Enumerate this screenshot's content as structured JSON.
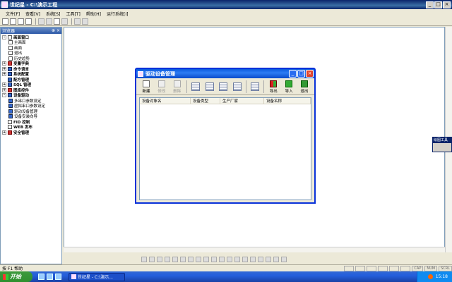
{
  "window": {
    "title": "世纪星 - C:\\演示工程",
    "controls": [
      "_",
      "□",
      "×"
    ]
  },
  "menu": [
    "文件[F]",
    "查看[V]",
    "系统[S]",
    "工具[T]",
    "帮助[H]",
    "运行系统[I]"
  ],
  "explorer": {
    "title": "浏览器",
    "tree": [
      {
        "label": "画面窗口",
        "level": 0,
        "expander": "-",
        "icon": "page",
        "bold": true
      },
      {
        "label": "主画面",
        "level": 1,
        "icon": "page"
      },
      {
        "label": "画面",
        "level": 1,
        "icon": "page"
      },
      {
        "label": "退出",
        "level": 1,
        "icon": "page"
      },
      {
        "label": "历史趋势",
        "level": 1,
        "icon": "page"
      },
      {
        "label": "变量字典",
        "level": 0,
        "expander": "+",
        "icon": "red",
        "bold": true
      },
      {
        "label": "命令语言",
        "level": 0,
        "expander": "+",
        "icon": "blue",
        "bold": true
      },
      {
        "label": "系统配置",
        "level": 0,
        "expander": "+",
        "icon": "blue",
        "bold": true
      },
      {
        "label": "配方管理",
        "level": 0,
        "expander": "",
        "icon": "blue",
        "bold": true
      },
      {
        "label": "SQL 管理",
        "level": 0,
        "expander": "+",
        "icon": "blue",
        "bold": true
      },
      {
        "label": "图库控件",
        "level": 0,
        "expander": "+",
        "icon": "red",
        "bold": true
      },
      {
        "label": "设备驱动",
        "level": 0,
        "expander": "-",
        "icon": "blue",
        "bold": true
      },
      {
        "label": "多串口参数设定",
        "level": 1,
        "icon": "blue"
      },
      {
        "label": "虚拟串口参数设定",
        "level": 1,
        "icon": "blue"
      },
      {
        "label": "驱动设备管理",
        "level": 1,
        "icon": "blue"
      },
      {
        "label": "设备安装向导",
        "level": 1,
        "icon": "blue"
      },
      {
        "label": "FID 控制",
        "level": 0,
        "expander": "",
        "icon": "page",
        "bold": true
      },
      {
        "label": "WEB 发布",
        "level": 0,
        "expander": "",
        "icon": "page",
        "bold": true
      },
      {
        "label": "安全管理",
        "level": 0,
        "expander": "+",
        "icon": "red",
        "bold": true
      }
    ]
  },
  "draw_tools": {
    "title": "绘图工具"
  },
  "dialog": {
    "title": "驱动设备管理",
    "buttons": {
      "new": "新建",
      "modify": "修改",
      "delete": "删除",
      "export": "导出",
      "import": "导入",
      "exit": "退出"
    },
    "columns": [
      "设备对象名",
      "设备类型",
      "生产厂家",
      "设备名称"
    ]
  },
  "status": {
    "help": "按 F1 帮助",
    "cells": [
      "",
      "",
      "",
      "",
      "",
      "",
      "CAP",
      "NUM",
      "SCRL"
    ]
  },
  "taskbar": {
    "start": "开始",
    "task": "世纪星 - C:\\演示...",
    "clock": "15:18"
  }
}
